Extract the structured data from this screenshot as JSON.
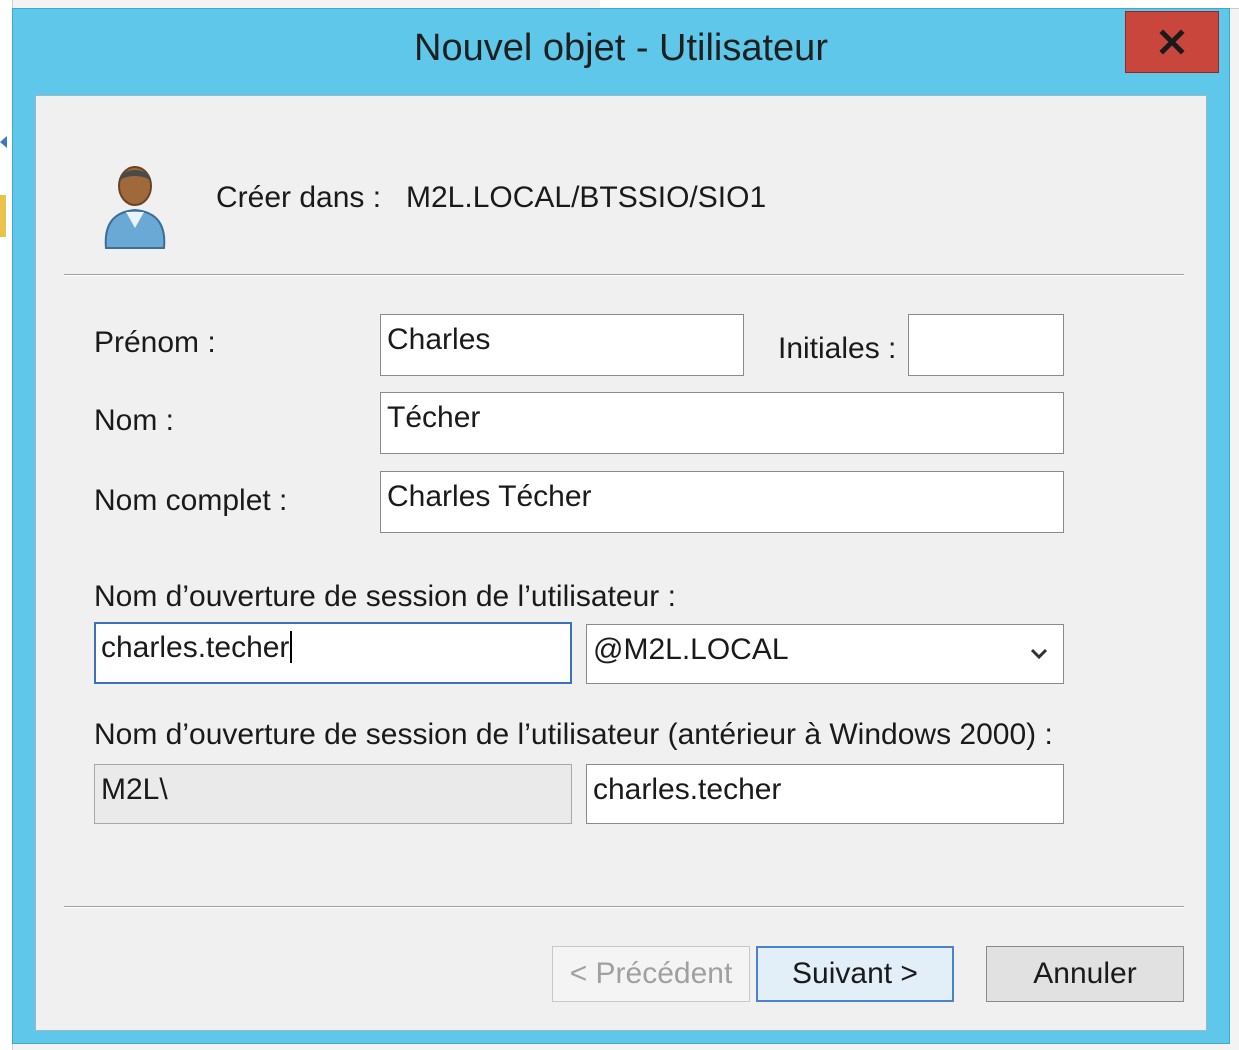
{
  "window": {
    "title": "Nouvel objet - Utilisateur",
    "close_symbol": "x"
  },
  "header": {
    "create_in_label": "Créer dans :",
    "create_in_value": "M2L.LOCAL/BTSSIO/SIO1",
    "icon": "user-icon"
  },
  "form": {
    "first_name_label": "Prénom :",
    "first_name_value": "Charles",
    "initials_label": "Initiales :",
    "initials_value": "",
    "last_name_label": "Nom :",
    "last_name_value": "Técher",
    "full_name_label": "Nom complet :",
    "full_name_value": "Charles Técher",
    "logon_label": "Nom d’ouverture de session de l’utilisateur :",
    "logon_value": "charles.techer",
    "domain_selected": "@M2L.LOCAL",
    "pre2000_label": "Nom d’ouverture de session de l’utilisateur (antérieur à Windows 2000) :",
    "pre2000_domain": "M2L\\",
    "pre2000_value": "charles.techer"
  },
  "buttons": {
    "previous": "< Précédent",
    "next": "Suivant >",
    "cancel": "Annuler"
  },
  "colors": {
    "title_bar": "#5ec7ea",
    "close_button": "#c9463d",
    "client_bg": "#f0f0f0",
    "focus_border": "#3a73b5"
  }
}
